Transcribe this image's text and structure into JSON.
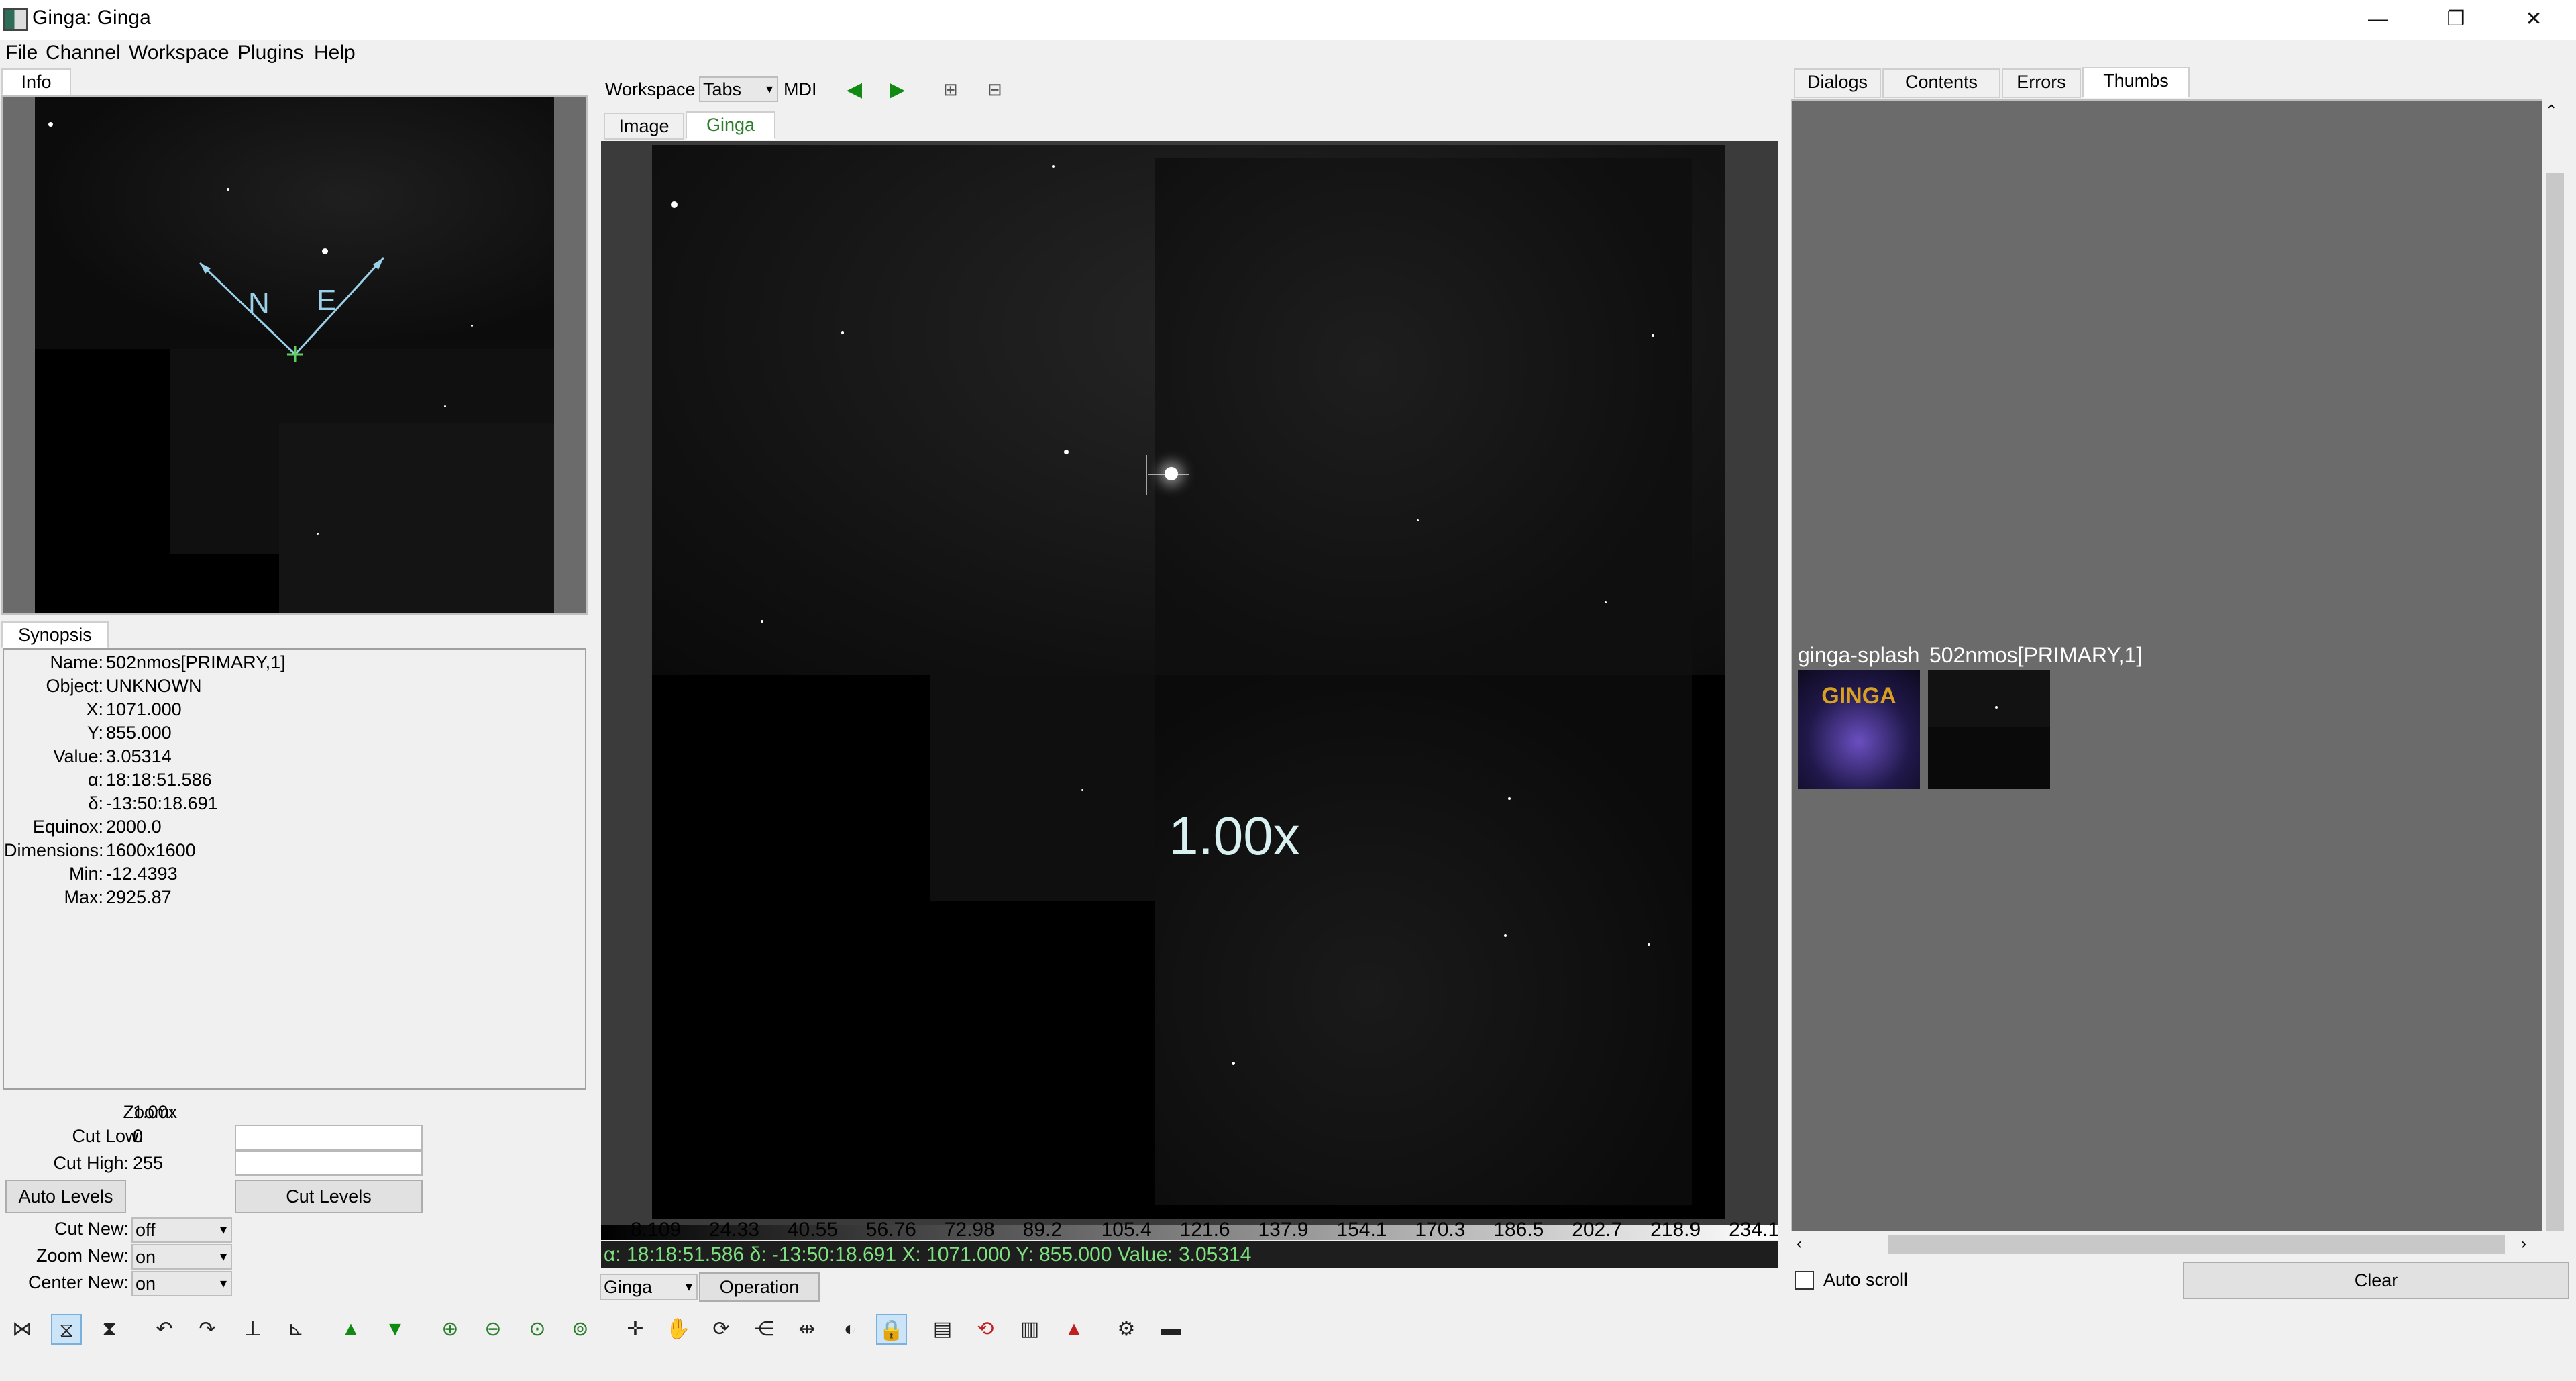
{
  "window": {
    "title": "Ginga: Ginga",
    "minimize": "—",
    "restore": "❐",
    "close": "✕",
    "icon": "ginga-app-icon"
  },
  "menubar": [
    "File",
    "Channel",
    "Workspace",
    "Plugins",
    "Help"
  ],
  "left_panel": {
    "info_tab": "Info",
    "pan_labels": {
      "north": "N",
      "east": "E"
    },
    "synopsis_tab": "Synopsis",
    "fields": [
      {
        "label": "Name:",
        "value": "502nmos[PRIMARY,1]"
      },
      {
        "label": "Object:",
        "value": "UNKNOWN"
      },
      {
        "label": "X:",
        "value": "1071.000"
      },
      {
        "label": "Y:",
        "value": "855.000"
      },
      {
        "label": "Value:",
        "value": "3.05314"
      },
      {
        "label": "α:",
        "value": "18:18:51.586"
      },
      {
        "label": "δ:",
        "value": "-13:50:18.691"
      },
      {
        "label": "Equinox:",
        "value": "2000.0"
      },
      {
        "label": "Dimensions:",
        "value": "1600x1600"
      },
      {
        "label": "Min:",
        "value": "-12.4393"
      },
      {
        "label": "Max:",
        "value": "2925.87"
      }
    ],
    "zoom": {
      "label": "Zoom:",
      "value": "1.00x"
    },
    "cut_low": {
      "label": "Cut Low:",
      "value": "0"
    },
    "cut_high": {
      "label": "Cut High:",
      "value": "255"
    },
    "auto_levels": "Auto Levels",
    "cut_levels": "Cut Levels",
    "cut_new": {
      "label": "Cut New:",
      "value": "off"
    },
    "zoom_new": {
      "label": "Zoom New:",
      "value": "on"
    },
    "center_new": {
      "label": "Center New:",
      "value": "on"
    }
  },
  "center": {
    "workspace_label": "Workspace",
    "workspace_mode": "Tabs",
    "mdi_label": "MDI",
    "tabs": [
      "Image",
      "Ginga"
    ],
    "active_tab": "Ginga",
    "zoom_overlay": "1.00x",
    "colorbar_ticks": [
      "8.109",
      "24.33",
      "40.55",
      "56.76",
      "72.98",
      "89.2",
      "105.4",
      "121.6",
      "137.9",
      "154.1",
      "170.3",
      "186.5",
      "202.7",
      "218.9",
      "234.1"
    ],
    "readout": "α: 18:18:51.586   δ: -13:50:18.691   X: 1071.000  Y: 855.000   Value: 3.05314",
    "channel": "Ginga",
    "operation": "Operation"
  },
  "right_panel": {
    "tabs": [
      "Dialogs",
      "Contents",
      "Errors",
      "Thumbs"
    ],
    "active_tab": "Thumbs",
    "thumbs": [
      {
        "label": "ginga-splash",
        "caption": "GINGA"
      },
      {
        "label": "502nmos[PRIMARY,1]",
        "caption": ""
      }
    ],
    "auto_scroll": "Auto scroll",
    "clear": "Clear"
  },
  "toolbar": {
    "icons": [
      "flip-x-icon",
      "flip-y-icon",
      "swap-xy-icon",
      "rotate-ccw-icon",
      "rotate-cw-icon",
      "orient-lh-icon",
      "orient-rh-icon",
      "prev-image-icon",
      "next-image-icon",
      "zoom-in-icon",
      "zoom-out-icon",
      "zoom-1to1-icon",
      "zoom-fit-icon",
      "pan-mode-icon",
      "free-pan-icon",
      "rotate-mode-icon",
      "dist-mode-icon",
      "contrast-mode-icon",
      "cut-mode-icon",
      "lock-icon",
      "cmap-icon",
      "reset-contrast-icon",
      "reset-rotation-icon",
      "reset-cmap-icon",
      "settings-icon",
      "save-icon"
    ]
  },
  "colors": {
    "tab_active_text": "#2a7d2a",
    "readout_bg": "#1e1e1e",
    "readout_text": "#7ee07e",
    "arrow_green": "#108a10",
    "compass": "#9ad0e8"
  }
}
